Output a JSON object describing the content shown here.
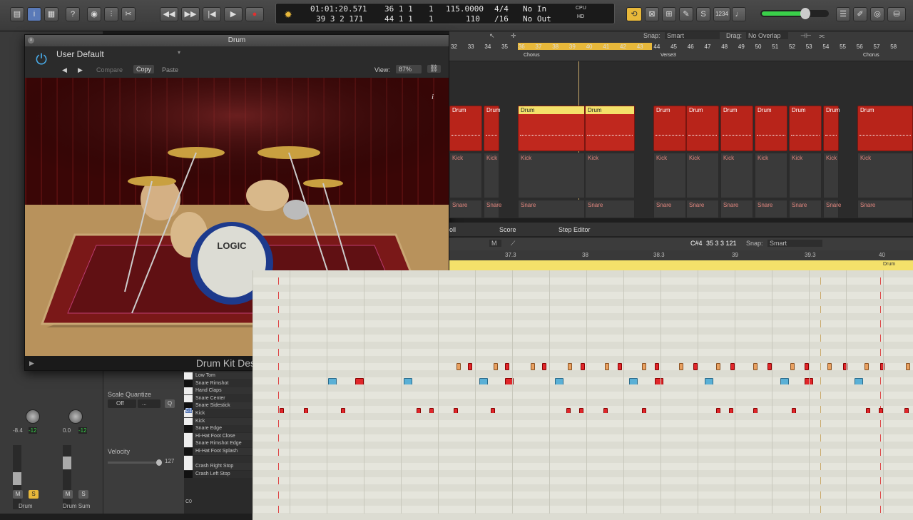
{
  "toolbar": {
    "icons": [
      "library-icon",
      "info-icon",
      "toolbar-icon",
      "help-icon",
      "smart-controls-icon",
      "mixer-icon",
      "editors-icon"
    ],
    "transport": [
      "rewind-icon",
      "fastforward-icon",
      "gotostart-icon",
      "play-icon",
      "record-icon"
    ]
  },
  "lcd": {
    "time": "01:01:20.571",
    "bars": "39  3  2  171",
    "pos1": "36  1  1",
    "pos1b": "1",
    "pos2": "44  1  1",
    "pos2b": "1",
    "tempo": "115.0000",
    "tempo2": "110",
    "sig": "4/4",
    "div": "/16",
    "in": "No In",
    "out": "No Out",
    "cpu": "CPU",
    "hd": "HD"
  },
  "right_toolbar": {
    "count": "1234"
  },
  "plugin": {
    "window_title": "Drum",
    "preset": "User Default",
    "compare": "Compare",
    "copy": "Copy",
    "paste": "Paste",
    "view_label": "View:",
    "view_value": "87%",
    "footer": "Drum Kit Designer",
    "logo": "LOGIC"
  },
  "tracks_header": {
    "snap_label": "Snap:",
    "snap_value": "Smart",
    "drag_label": "Drag:",
    "drag_value": "No Overlap"
  },
  "ruler": {
    "bars": [
      "32",
      "33",
      "34",
      "35",
      "36",
      "37",
      "38",
      "39",
      "40",
      "41",
      "42",
      "43",
      "44",
      "45",
      "46",
      "47",
      "48",
      "49",
      "50",
      "51",
      "52",
      "53",
      "54",
      "55",
      "56",
      "57",
      "58"
    ],
    "markers": [
      "Chorus",
      "Verse3",
      "Chorus"
    ]
  },
  "regions": {
    "drum": "Drum",
    "kick": "Kick",
    "snare": "Snare"
  },
  "editor": {
    "tabs": [
      "oll",
      "Score",
      "Step Editor"
    ],
    "note": "C#4",
    "pos": "35 3 3 121",
    "snap_label": "Snap:",
    "snap_value": "Smart",
    "ruler": [
      "37.3",
      "38",
      "38.3",
      "39",
      "39.3",
      "40"
    ],
    "region": "Drum",
    "mode": "M"
  },
  "keys": [
    "Low Tom",
    "Snare Rimshot",
    "Hand Claps",
    "Snare Center",
    "Snare Sidestick",
    "Kick",
    "Kick",
    "Snare Edge",
    "Hi-Hat Foot Close",
    "Snare Rimshot Edge",
    "Hi-Hat Foot Splash",
    "",
    "Crash Right Stop",
    "Crash Left Stop"
  ],
  "key_octaves": [
    "C1",
    "C0"
  ],
  "inspector": {
    "scale_quantize": "Scale Quantize",
    "sq_off": "Off",
    "sq_dots": "...",
    "sq_q": "Q",
    "velocity": "Velocity",
    "vel_value": "127",
    "ch1_vol": "-8.4",
    "ch1_peak": "-12",
    "ch2_vol": "0.0",
    "ch2_peak": "-12",
    "ch1_name": "Drum",
    "ch2_name": "Drum Sum",
    "m": "M",
    "s": "S"
  }
}
